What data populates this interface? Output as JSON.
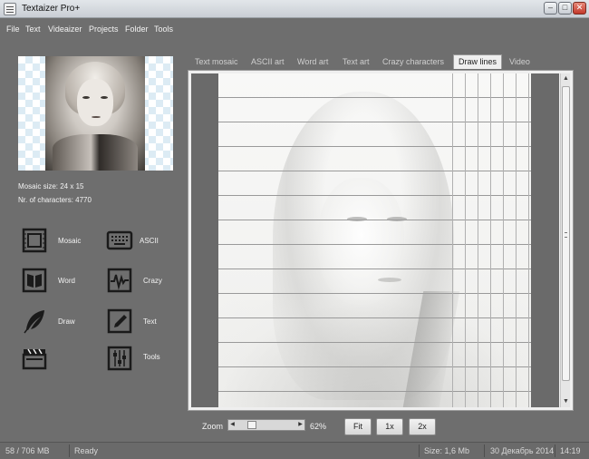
{
  "window": {
    "title": "Textaizer Pro+"
  },
  "menu": [
    "File",
    "Text",
    "Videaizer",
    "Projects",
    "Folder",
    "Tools"
  ],
  "info": {
    "mosaic_size": "Mosaic size: 24 x 15",
    "nr_characters": "Nr. of characters: 4770"
  },
  "tools": [
    {
      "label": "Mosaic",
      "icon": "mosaic-icon"
    },
    {
      "label": "ASCII",
      "icon": "keyboard-icon"
    },
    {
      "label": "Word",
      "icon": "book-icon"
    },
    {
      "label": "Crazy",
      "icon": "wave-icon"
    },
    {
      "label": "Draw",
      "icon": "feather-icon"
    },
    {
      "label": "Text",
      "icon": "pencil-icon"
    },
    {
      "label": "",
      "icon": "clapperboard-icon"
    },
    {
      "label": "Tools",
      "icon": "sliders-icon"
    }
  ],
  "tabs": [
    {
      "label": "Text mosaic",
      "active": false
    },
    {
      "label": "ASCII art",
      "active": false
    },
    {
      "label": "Word art",
      "active": false
    },
    {
      "label": "Text art",
      "active": false
    },
    {
      "label": "Crazy characters",
      "active": false
    },
    {
      "label": "Draw lines",
      "active": true
    },
    {
      "label": "Video",
      "active": false
    }
  ],
  "zoom": {
    "label": "Zoom",
    "value": "62%",
    "level": 0.62
  },
  "buttons": {
    "fit": "Fit",
    "x1": "1x",
    "x2": "2x"
  },
  "status": {
    "memory": "58 / 706 MB",
    "state": "Ready",
    "size": "Size: 1,6 Mb",
    "date": "30 Декабрь 2014",
    "time": "14:19"
  }
}
